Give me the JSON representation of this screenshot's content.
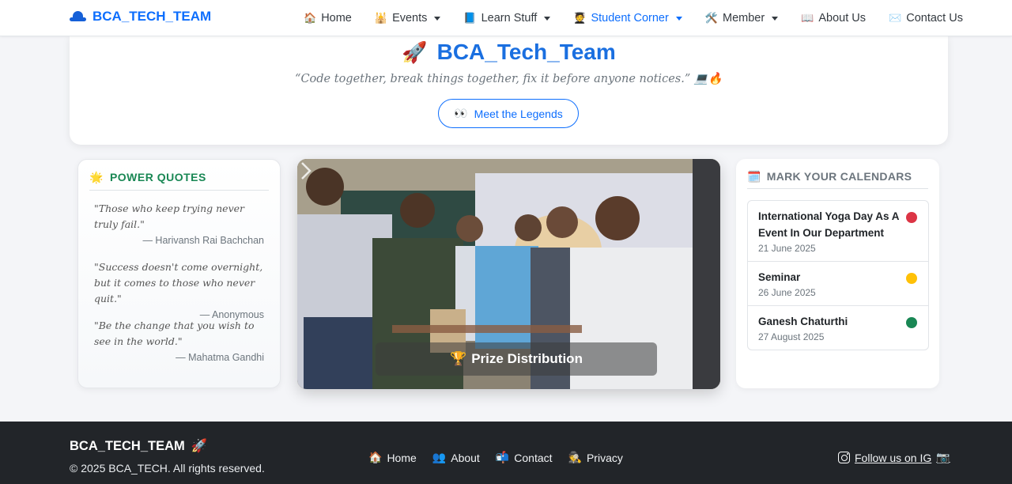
{
  "navbar": {
    "brand": "BCA_TECH_TEAM",
    "brand_icon": "hat-icon",
    "items": [
      {
        "icon": "🏠",
        "label": "Home",
        "dropdown": false,
        "active": false
      },
      {
        "icon": "🕌",
        "label": "Events",
        "dropdown": true,
        "active": false
      },
      {
        "icon": "📘",
        "label": "Learn Stuff",
        "dropdown": true,
        "active": false
      },
      {
        "icon": "🧑‍🎓",
        "label": "Student Corner",
        "dropdown": true,
        "active": true
      },
      {
        "icon": "🛠️",
        "label": "Member",
        "dropdown": true,
        "active": false
      },
      {
        "icon": "📖",
        "label": "About Us",
        "dropdown": false,
        "active": false
      },
      {
        "icon": "✉️",
        "label": "Contact Us",
        "dropdown": false,
        "active": false
      }
    ]
  },
  "hero": {
    "icon": "🚀",
    "title": "BCA_Tech_Team",
    "tagline": "“Code together, break things together, fix it before anyone notices.” 💻🔥",
    "button_icon": "👀",
    "button_label": "Meet the Legends"
  },
  "quotes": {
    "icon": "🌟",
    "heading": "POWER QUOTES",
    "items": [
      {
        "text": "\"Those who keep trying never truly fail.\"",
        "author": "— Harivansh Rai Bachchan"
      },
      {
        "text": "\"Success doesn't come overnight, but it comes to those who never quit.\"",
        "author": "— Anonymous"
      },
      {
        "text": "\"Be the change that you wish to see in the world.\"",
        "author": "— Mahatma Gandhi"
      }
    ]
  },
  "carousel": {
    "caption_icon": "🏆",
    "caption": "Prize Distribution",
    "next_icon": "chevron-right-icon"
  },
  "calendar": {
    "icon": "🗓️",
    "heading": "MARK YOUR CALENDARS",
    "events": [
      {
        "name": "International Yoga Day As A Event In Our Department",
        "date": "21 June 2025",
        "color": "#dc3545"
      },
      {
        "name": "Seminar",
        "date": "26 June 2025",
        "color": "#ffc107"
      },
      {
        "name": "Ganesh Chaturthi",
        "date": "27 August 2025",
        "color": "#198754"
      }
    ]
  },
  "footer": {
    "brand": "BCA_TECH_TEAM",
    "brand_icon": "🚀",
    "copyright": "© 2025 BCA_TECH. All rights reserved.",
    "links": [
      {
        "icon": "🏠",
        "label": "Home"
      },
      {
        "icon": "👥",
        "label": "About"
      },
      {
        "icon": "📬",
        "label": "Contact"
      },
      {
        "icon": "🕵️",
        "label": "Privacy"
      }
    ],
    "instagram_label": "Follow us on IG",
    "instagram_icon": "instagram-icon",
    "instagram_emoji": "📷"
  }
}
